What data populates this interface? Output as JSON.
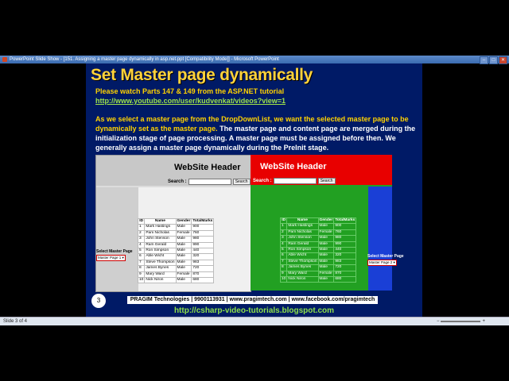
{
  "window": {
    "title": "PowerPoint Slide Show - [151. Assigning a master page dynamically in asp.net.ppt [Compatibility Mode]] - Microsoft PowerPoint",
    "min": "–",
    "max": "□",
    "close": "✕"
  },
  "slide": {
    "title": "Set Master page dynamically",
    "line1": "Please watch Parts 147 & 149 from the ASP.NET tutorial",
    "link": "http://www.youtube.com/user/kudvenkat/videos?view=1",
    "para_highlight": "As we select a master page from the DropDownList, we want the selected master page to be dynamically set as the master page.",
    "para_rest": " The master page and content page are merged during the initialization stage of page processing. A master page must be assigned before then. We generally assign a master page dynamically during the PreInit stage.",
    "slide_number": "3",
    "footer": "PRAGIM Technologies | 9900113931 | www.pragimtech.com | www.facebook.com/pragimtech",
    "blog": "http://csharp-video-tutorials.blogspot.com"
  },
  "mock1": {
    "header": "WebSite Header",
    "search_label": "Search :",
    "search_button": "Search",
    "select_label": "Select Master Page",
    "select_value": "Master Page 1",
    "colors": {
      "header": "#c8c8c8",
      "side": "#cfcfcf",
      "content": "#f0f0f0"
    }
  },
  "mock2": {
    "header": "WebSite Header",
    "search_label": "Search :",
    "search_button": "Search",
    "select_label": "Select Master Page",
    "select_value": "Master Page 2",
    "colors": {
      "header": "#e80000",
      "side": "#1a3fd6",
      "content": "#22a022"
    }
  },
  "table": {
    "columns": [
      "ID",
      "Name",
      "Gender",
      "TotalMarks"
    ],
    "rows": [
      [
        "1",
        "Mark Hastings",
        "Male",
        "900"
      ],
      [
        "2",
        "Pam Nicholas",
        "Female",
        "760"
      ],
      [
        "3",
        "John Stenson",
        "Male",
        "980"
      ],
      [
        "4",
        "Ram Gerald",
        "Male",
        "990"
      ],
      [
        "5",
        "Ron Simpson",
        "Male",
        "440"
      ],
      [
        "6",
        "Able Wicht",
        "Male",
        "320"
      ],
      [
        "7",
        "Steve Thompson",
        "Male",
        "983"
      ],
      [
        "8",
        "James Bynes",
        "Male",
        "720"
      ],
      [
        "9",
        "Mary Ward",
        "Female",
        "870"
      ],
      [
        "10",
        "Nick Niron",
        "Male",
        "680"
      ]
    ]
  },
  "status": {
    "slide_info": "Slide 3 of 4"
  }
}
